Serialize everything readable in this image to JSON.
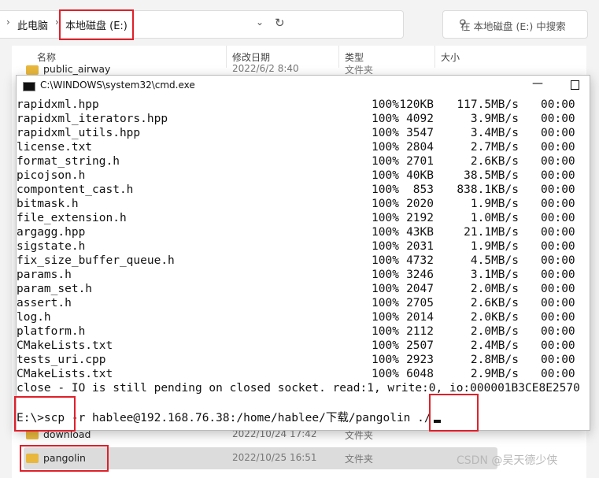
{
  "explorer": {
    "breadcrumb": [
      "此电脑",
      "本地磁盘 (E:)"
    ],
    "search_placeholder": "在 本地磁盘 (E:) 中搜索",
    "columns": [
      "名称",
      "修改日期",
      "类型",
      "大小"
    ],
    "rows": [
      {
        "name": "public_airway",
        "date": "2022/6/2 8:40",
        "type": "文件夹"
      },
      {
        "name": "download",
        "date": "2022/10/24 17:42",
        "type": "文件夹"
      },
      {
        "name": "pangolin",
        "date": "2022/10/25 16:51",
        "type": "文件夹"
      }
    ]
  },
  "cmd": {
    "title": "C:\\WINDOWS\\system32\\cmd.exe",
    "transfers": [
      [
        "rapidxml.hpp",
        "100%",
        "120KB",
        "117.5MB/s",
        "00:00"
      ],
      [
        "rapidxml_iterators.hpp",
        "100%",
        "4092",
        "3.9MB/s",
        "00:00"
      ],
      [
        "rapidxml_utils.hpp",
        "100%",
        "3547",
        "3.4MB/s",
        "00:00"
      ],
      [
        "license.txt",
        "100%",
        "2804",
        "2.7MB/s",
        "00:00"
      ],
      [
        "format_string.h",
        "100%",
        "2701",
        "2.6KB/s",
        "00:00"
      ],
      [
        "picojson.h",
        "100%",
        "40KB",
        "38.5MB/s",
        "00:00"
      ],
      [
        "compontent_cast.h",
        "100%",
        "853",
        "838.1KB/s",
        "00:00"
      ],
      [
        "bitmask.h",
        "100%",
        "2020",
        "1.9MB/s",
        "00:00"
      ],
      [
        "file_extension.h",
        "100%",
        "2192",
        "1.0MB/s",
        "00:00"
      ],
      [
        "argagg.hpp",
        "100%",
        "43KB",
        "21.1MB/s",
        "00:00"
      ],
      [
        "sigstate.h",
        "100%",
        "2031",
        "1.9MB/s",
        "00:00"
      ],
      [
        "fix_size_buffer_queue.h",
        "100%",
        "4732",
        "4.5MB/s",
        "00:00"
      ],
      [
        "params.h",
        "100%",
        "3246",
        "3.1MB/s",
        "00:00"
      ],
      [
        "param_set.h",
        "100%",
        "2047",
        "2.0MB/s",
        "00:00"
      ],
      [
        "assert.h",
        "100%",
        "2705",
        "2.6KB/s",
        "00:00"
      ],
      [
        "log.h",
        "100%",
        "2014",
        "2.0KB/s",
        "00:00"
      ],
      [
        "platform.h",
        "100%",
        "2112",
        "2.0MB/s",
        "00:00"
      ],
      [
        "CMakeLists.txt",
        "100%",
        "2507",
        "2.4MB/s",
        "00:00"
      ],
      [
        "tests_uri.cpp",
        "100%",
        "2923",
        "2.8MB/s",
        "00:00"
      ],
      [
        "CMakeLists.txt",
        "100%",
        "6048",
        "2.9MB/s",
        "00:00"
      ]
    ],
    "error_line": "close - IO is still pending on closed socket. read:1, write:0, io:000001B3CE8E2570",
    "prompt": "E:\\>",
    "command": "scp -r hablee@192.168.76.38:/home/hablee/下载/pangolin ./"
  },
  "watermark": "CSDN @吴天德少侠",
  "highlight_color": "#e0202a"
}
